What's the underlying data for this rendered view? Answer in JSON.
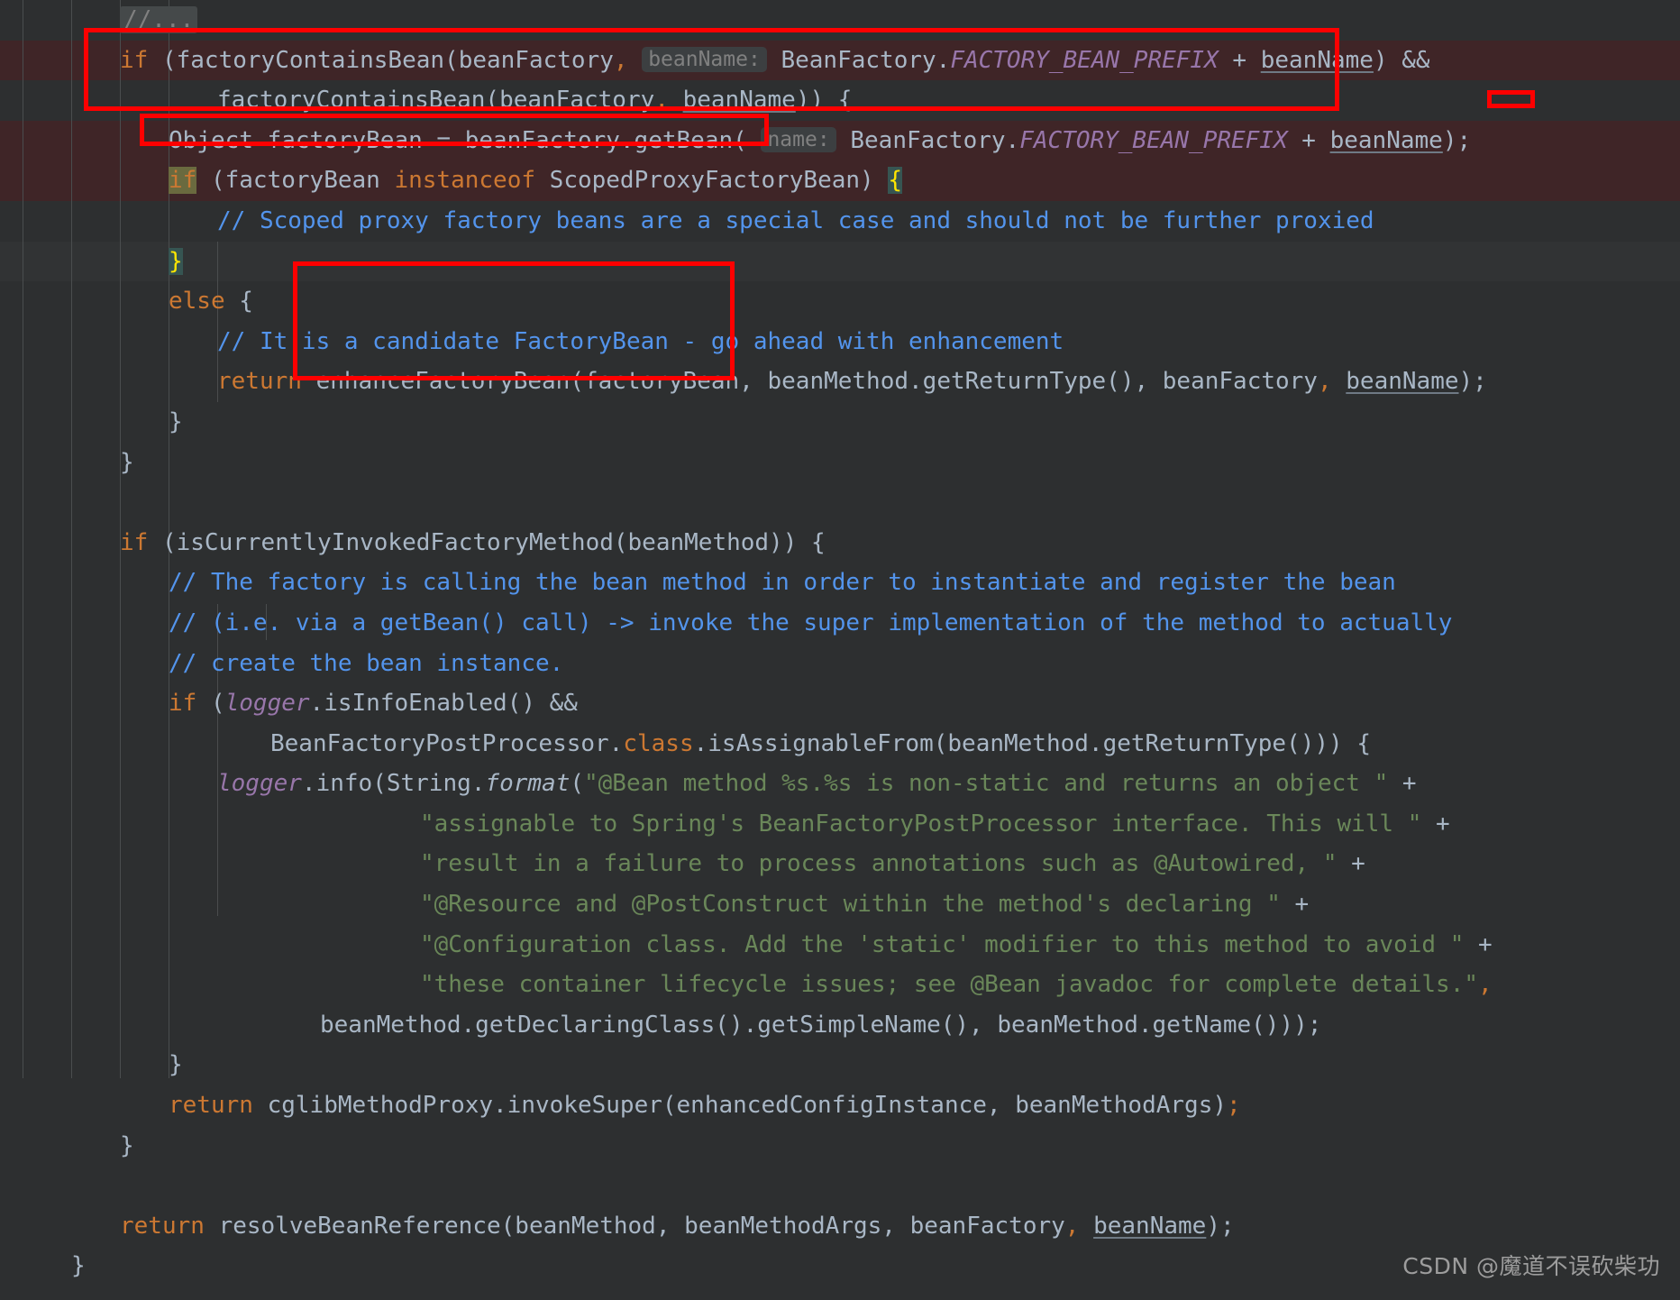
{
  "editor": {
    "theme": "darcula",
    "colors": {
      "background": "#2d2f30",
      "foreground": "#a9b7c6",
      "keyword": "#cc7832",
      "comment": "#5394ec",
      "string": "#6a8759",
      "static_field": "#9876aa",
      "highlighted_line": "#3f2527",
      "annotation_red": "#fe0000",
      "inlay_hint_text": "#808080",
      "inlay_hint_bg": "#3c3f41",
      "indent_guide": "#4a4d4e",
      "brace_match_bg": "#365552",
      "keyword_match_bg": "#6a6a3f"
    },
    "font_size_px": 26,
    "line_height_px": 44.6
  },
  "code": {
    "language": "java",
    "folded_marker": "//...",
    "lines": [
      {
        "n": 1,
        "highlight": "none",
        "text": "//..."
      },
      {
        "n": 2,
        "highlight": "red",
        "text": "if (factoryContainsBean(beanFactory,  beanName:  BeanFactory.FACTORY_BEAN_PREFIX + beanName) &&"
      },
      {
        "n": 3,
        "highlight": "none",
        "text": "        factoryContainsBean(beanFactory, beanName)) {"
      },
      {
        "n": 4,
        "highlight": "red",
        "text": "    Object factoryBean = beanFactory.getBean( name:  BeanFactory.FACTORY_BEAN_PREFIX + beanName);"
      },
      {
        "n": 5,
        "highlight": "red",
        "text": "    if (factoryBean instanceof ScopedProxyFactoryBean) {"
      },
      {
        "n": 6,
        "highlight": "none",
        "text": "        // Scoped proxy factory beans are a special case and should not be further proxied"
      },
      {
        "n": 7,
        "highlight": "soft",
        "text": "    }"
      },
      {
        "n": 8,
        "highlight": "none",
        "text": "    else {"
      },
      {
        "n": 9,
        "highlight": "none",
        "text": "        // It is a candidate FactoryBean - go ahead with enhancement"
      },
      {
        "n": 10,
        "highlight": "none",
        "text": "        return enhanceFactoryBean(factoryBean, beanMethod.getReturnType(), beanFactory, beanName);"
      },
      {
        "n": 11,
        "highlight": "none",
        "text": "    }"
      },
      {
        "n": 12,
        "highlight": "none",
        "text": "}"
      },
      {
        "n": 13,
        "highlight": "none",
        "text": ""
      },
      {
        "n": 14,
        "highlight": "none",
        "text": "if (isCurrentlyInvokedFactoryMethod(beanMethod)) {"
      },
      {
        "n": 15,
        "highlight": "none",
        "text": "    // The factory is calling the bean method in order to instantiate and register the bean"
      },
      {
        "n": 16,
        "highlight": "none",
        "text": "    // (i.e. via a getBean() call) -> invoke the super implementation of the method to actually"
      },
      {
        "n": 17,
        "highlight": "none",
        "text": "    // create the bean instance."
      },
      {
        "n": 18,
        "highlight": "none",
        "text": "    if (logger.isInfoEnabled() &&"
      },
      {
        "n": 19,
        "highlight": "none",
        "text": "            BeanFactoryPostProcessor.class.isAssignableFrom(beanMethod.getReturnType())) {"
      },
      {
        "n": 20,
        "highlight": "none",
        "text": "        logger.info(String.format(\"@Bean method %s.%s is non-static and returns an object \" +"
      },
      {
        "n": 21,
        "highlight": "none",
        "text": "                    \"assignable to Spring's BeanFactoryPostProcessor interface. This will \" +"
      },
      {
        "n": 22,
        "highlight": "none",
        "text": "                    \"result in a failure to process annotations such as @Autowired, \" +"
      },
      {
        "n": 23,
        "highlight": "none",
        "text": "                    \"@Resource and @PostConstruct within the method's declaring \" +"
      },
      {
        "n": 24,
        "highlight": "none",
        "text": "                    \"@Configuration class. Add the 'static' modifier to this method to avoid \" +"
      },
      {
        "n": 25,
        "highlight": "none",
        "text": "                    \"these container lifecycle issues; see @Bean javadoc for complete details.\","
      },
      {
        "n": 26,
        "highlight": "none",
        "text": "                beanMethod.getDeclaringClass().getSimpleName(), beanMethod.getName()));"
      },
      {
        "n": 27,
        "highlight": "none",
        "text": "    }"
      },
      {
        "n": 28,
        "highlight": "none",
        "text": "    return cglibMethodProxy.invokeSuper(enhancedConfigInstance, beanMethodArgs);"
      },
      {
        "n": 29,
        "highlight": "none",
        "text": "}"
      },
      {
        "n": 30,
        "highlight": "none",
        "text": ""
      },
      {
        "n": 31,
        "highlight": "none",
        "text": "return resolveBeanReference(beanMethod, beanMethodArgs, beanFactory, beanName);"
      },
      {
        "n": 32,
        "highlight": "none",
        "text": "}"
      }
    ],
    "inlay_hints": [
      {
        "label": "beanName:",
        "line": 2
      },
      {
        "label": "name:",
        "line": 4
      }
    ]
  },
  "annotations": {
    "boxes": [
      {
        "id": "anno-1",
        "label": "factory-contains-bean-condition-box"
      },
      {
        "id": "anno-2",
        "label": "get-factory-bean-statement-box"
      },
      {
        "id": "anno-3",
        "label": "enhance-factory-bean-return-box"
      },
      {
        "id": "anno-4",
        "label": "small-marker-box"
      }
    ],
    "color": "#fe0000"
  },
  "watermark": {
    "text": "CSDN @魔道不误砍柴功"
  }
}
